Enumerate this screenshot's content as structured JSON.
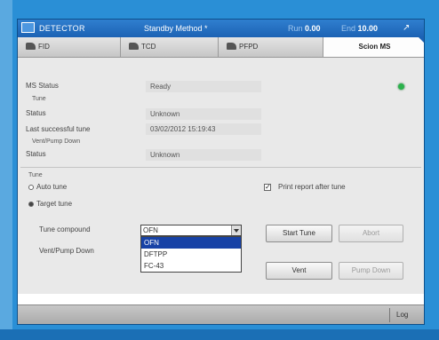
{
  "titlebar": {
    "app_title": "DETECTOR",
    "method": "Standby Method *",
    "run_label": "Run",
    "run_value": "0.00",
    "end_label": "End",
    "end_value": "10.00",
    "net_glyph": "↗"
  },
  "tabs": [
    {
      "label": "FID",
      "active": false
    },
    {
      "label": "TCD",
      "active": false
    },
    {
      "label": "PFPD",
      "active": false
    },
    {
      "label": "Scion MS",
      "active": true
    }
  ],
  "ms_status": {
    "ms_status_label": "MS Status",
    "ms_status_value": "Ready",
    "tune_section": "Tune",
    "status_label": "Status",
    "status_value": "Unknown",
    "last_tune_label": "Last successful tune",
    "last_tune_value": "03/02/2012 15:19:43",
    "vent_section": "Vent/Pump Down",
    "vent_status_label": "Status",
    "vent_status_value": "Unknown"
  },
  "tune": {
    "section_label": "Tune",
    "auto_tune_label": "Auto tune",
    "target_tune_label": "Target tune",
    "selected_mode": "target",
    "tune_compound_label": "Tune compound",
    "tune_compound_value": "OFN",
    "compound_options": [
      "OFN",
      "DFTPP",
      "FC-43"
    ],
    "highlighted_option": "OFN",
    "print_report_label": "Print report after tune",
    "print_report_checked": true,
    "start_tune_label": "Start Tune",
    "abort_label": "Abort",
    "vent_pump_label": "Vent/Pump Down",
    "vent_button_label": "Vent",
    "pump_down_label": "Pump Down"
  },
  "statusbar": {
    "log_label": "Log"
  }
}
